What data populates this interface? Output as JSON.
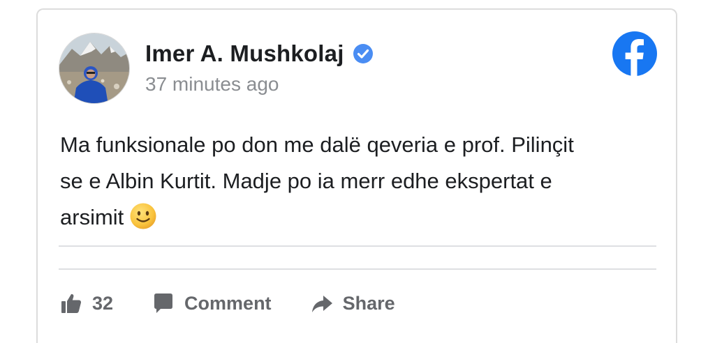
{
  "post": {
    "author": "Imer A. Mushkolaj",
    "verified": true,
    "timestamp": "37 minutes ago",
    "text_lines": [
      "Ma funksionale po don me dalë qeveria e prof. Pilinçit",
      "se e Albin Kurtit. Madje po ia merr edhe ekspertat e",
      "arsimit"
    ],
    "emoji": "slightly-smiling-face-emoji"
  },
  "actions": {
    "like_count": "32",
    "comment_label": "Comment",
    "share_label": "Share"
  },
  "icons": {
    "brand": "facebook-logo-icon",
    "verified": "verified-badge-icon",
    "like": "thumbs-up-icon",
    "comment": "comment-bubble-icon",
    "share": "share-arrow-icon"
  },
  "colors": {
    "facebook_blue": "#1877F2",
    "verified_blue": "#4A8DF3",
    "muted_text": "#8A8D91",
    "action_gray": "#65676B",
    "divider": "#DEDFE2"
  }
}
